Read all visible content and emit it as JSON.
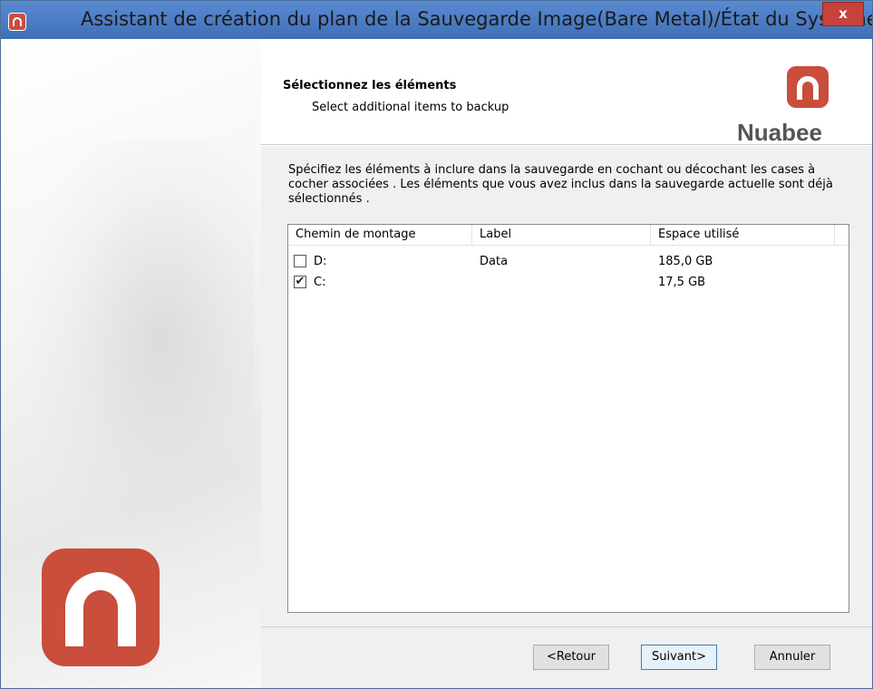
{
  "window": {
    "title": "Assistant de création du plan de la Sauvegarde Image(Bare Metal)/État du Système",
    "close_label": "x"
  },
  "header": {
    "title": "Sélectionnez les éléments",
    "subtitle": "Select additional items to backup",
    "brand": "Nuabee"
  },
  "description": "Spécifiez les éléments à inclure dans la sauvegarde en cochant ou décochant les cases à cocher associées . Les éléments que vous avez inclus dans la sauvegarde actuelle sont déjà sélectionnés .",
  "table": {
    "columns": [
      "Chemin de montage",
      "Label",
      "Espace utilisé"
    ],
    "rows": [
      {
        "path": "D:",
        "label": "Data",
        "space": "185,0 GB",
        "checked": false
      },
      {
        "path": "C:",
        "label": "",
        "space": "17,5 GB",
        "checked": true
      }
    ]
  },
  "buttons": {
    "back": "<Retour",
    "next": "Suivant>",
    "cancel": "Annuler"
  },
  "colors": {
    "brand_red": "#c94e3c",
    "titlebar": "#4c7cc2"
  }
}
